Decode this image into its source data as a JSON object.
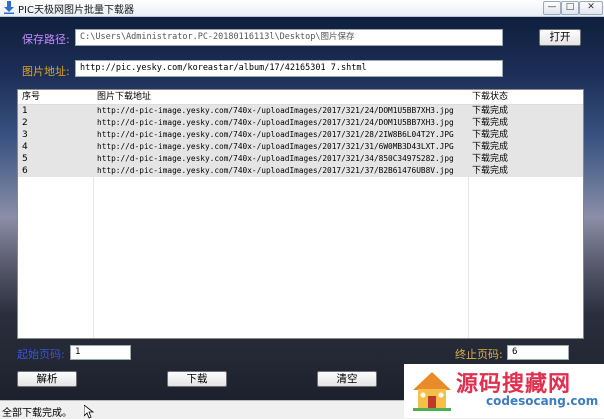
{
  "window": {
    "title": "PIC天极网图片批量下载器",
    "controls": {
      "minimize": "—",
      "maximize": "□",
      "close": "✕"
    }
  },
  "form": {
    "path_label": "保存路径:",
    "path_value": "C:\\Users\\Administrator.PC-20180116113l\\Desktop\\图片保存",
    "open_label": "打开",
    "url_label": "图片地址:",
    "url_value": "http://pic.yesky.com/koreastar/album/17/42165301 7.shtml"
  },
  "table": {
    "headers": {
      "id": "序号",
      "url": "图片下载地址",
      "status": "下载状态"
    },
    "rows": [
      {
        "id": "1",
        "url": "http://d-pic-image.yesky.com/740x-/uploadImages/2017/321/24/DOM1U5BB7XH3.jpg",
        "status": "下载完成"
      },
      {
        "id": "2",
        "url": "http://d-pic-image.yesky.com/740x-/uploadImages/2017/321/24/DOM1U5BB7XH3.jpg",
        "status": "下载完成"
      },
      {
        "id": "3",
        "url": "http://d-pic-image.yesky.com/740x-/uploadImages/2017/321/28/2IW8B6L04T2Y.JPG",
        "status": "下载完成"
      },
      {
        "id": "4",
        "url": "http://d-pic-image.yesky.com/740x-/uploadImages/2017/321/31/6W0MB3D43LXT.JPG",
        "status": "下载完成"
      },
      {
        "id": "5",
        "url": "http://d-pic-image.yesky.com/740x-/uploadImages/2017/321/34/850C3497S282.jpg",
        "status": "下载完成"
      },
      {
        "id": "6",
        "url": "http://d-pic-image.yesky.com/740x-/uploadImages/2017/321/37/B2B61476UB8V.jpg",
        "status": "下载完成"
      }
    ]
  },
  "pages": {
    "start_label": "起始页码:",
    "start_value": "1",
    "end_label": "终止页码:",
    "end_value": "6"
  },
  "buttons": {
    "parse": "解析",
    "download": "下载",
    "clear": "清空"
  },
  "status": {
    "text": "全部下载完成。"
  },
  "watermark": {
    "title": "源码搜藏网",
    "subtitle": "codesocang.com"
  }
}
